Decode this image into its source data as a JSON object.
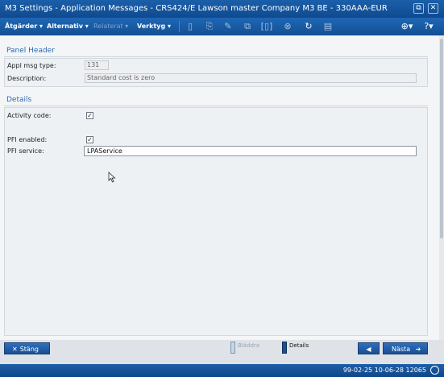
{
  "window": {
    "title": "M3 Settings - Application Messages - CRS424/E   Lawson master Company M3 BE - 330AAA-EUR",
    "restore_glyph": "⧉",
    "close_glyph": "✕"
  },
  "toolbar": {
    "menus": [
      {
        "label": "Åtgärder ▾",
        "enabled": true
      },
      {
        "label": "Alternativ ▾",
        "enabled": true
      },
      {
        "label": "Relaterat ▾",
        "enabled": false
      },
      {
        "label": "Verktyg ▾",
        "enabled": true
      }
    ],
    "icons": [
      {
        "name": "new-icon",
        "glyph": "▯"
      },
      {
        "name": "copy-icon",
        "glyph": "⎘"
      },
      {
        "name": "edit-icon",
        "glyph": "✎"
      },
      {
        "name": "duplicate-icon",
        "glyph": "⧉"
      },
      {
        "name": "bracket-icon",
        "glyph": "[▯]"
      },
      {
        "name": "delete-icon",
        "glyph": "⊗"
      },
      {
        "name": "refresh-icon",
        "glyph": "↻"
      },
      {
        "name": "document-icon",
        "glyph": "▤"
      }
    ],
    "zoom_glyph": "⊕▾",
    "help_glyph": "?▾"
  },
  "panel_header": {
    "title": "Panel Header",
    "appl_msg_type_label": "Appl msg type:",
    "appl_msg_type_value": "131",
    "description_label": "Description:",
    "description_value": "Standard cost is zero"
  },
  "details": {
    "title": "Details",
    "activity_code_label": "Activity code:",
    "activity_code_checked": true,
    "pfi_enabled_label": "PFI enabled:",
    "pfi_enabled_checked": true,
    "pfi_service_label": "PFI service:",
    "pfi_service_value": "LPAService"
  },
  "footer": {
    "close_label": "Stäng",
    "close_glyph": "✕",
    "panels": [
      {
        "label": "Bläddra",
        "state": "disabled"
      },
      {
        "label": "Details",
        "state": "current"
      }
    ],
    "back_glyph": "◀",
    "next_label": "Nästa",
    "next_glyph": "➔"
  },
  "status": {
    "text": "99-02-25 10-06-28 12065"
  },
  "colors": {
    "accent": "#1a4f93",
    "section_title": "#2a6bb4"
  }
}
